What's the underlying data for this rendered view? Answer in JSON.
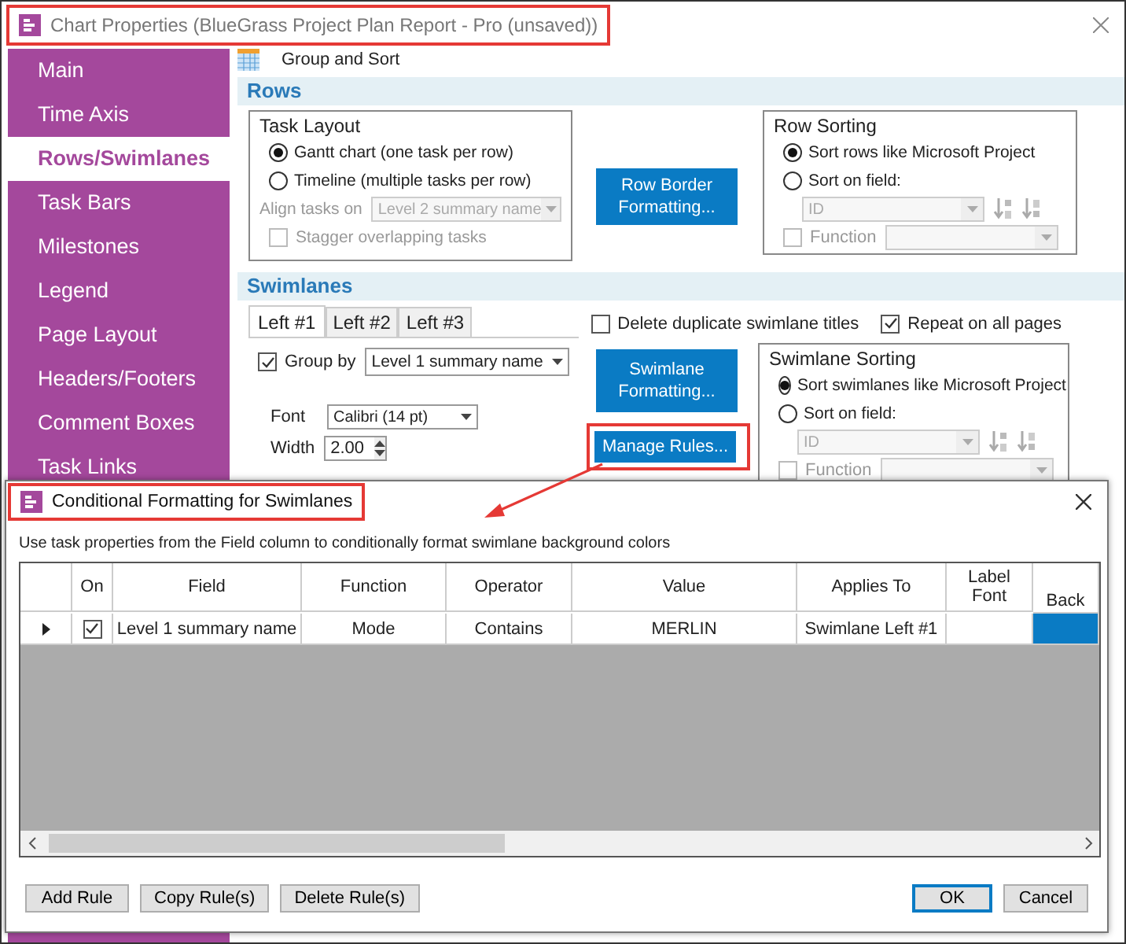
{
  "window": {
    "title": "Chart Properties (BlueGrass Project Plan Report - Pro (unsaved))"
  },
  "sidebar": {
    "items": [
      {
        "label": "Main",
        "selected": false
      },
      {
        "label": "Time Axis",
        "selected": false
      },
      {
        "label": "Rows/Swimlanes",
        "selected": true
      },
      {
        "label": "Task Bars",
        "selected": false
      },
      {
        "label": "Milestones",
        "selected": false
      },
      {
        "label": "Legend",
        "selected": false
      },
      {
        "label": "Page Layout",
        "selected": false
      },
      {
        "label": "Headers/Footers",
        "selected": false
      },
      {
        "label": "Comment Boxes",
        "selected": false
      },
      {
        "label": "Task Links",
        "selected": false
      }
    ]
  },
  "toolbar": {
    "label": "Group and Sort"
  },
  "rows_section": {
    "title": "Rows",
    "task_layout": {
      "title": "Task Layout",
      "options": [
        {
          "label": "Gantt chart (one task per row)",
          "selected": true
        },
        {
          "label": "Timeline (multiple tasks per row)",
          "selected": false
        }
      ],
      "align": {
        "label": "Align tasks on",
        "value": "Level 2 summary name",
        "disabled": true
      },
      "stagger": {
        "label": "Stagger overlapping tasks",
        "checked": false,
        "disabled": true
      }
    },
    "border_button": "Row Border Formatting...",
    "sorting": {
      "title": "Row Sorting",
      "options": [
        {
          "label": "Sort rows like Microsoft Project",
          "selected": true
        },
        {
          "label": "Sort on field:",
          "selected": false
        }
      ],
      "field": {
        "value": "ID",
        "disabled": true
      },
      "function": {
        "label": "Function",
        "checked": false,
        "disabled": true
      }
    }
  },
  "swimlanes_section": {
    "title": "Swimlanes",
    "tabs": [
      {
        "label": "Left #1",
        "selected": true
      },
      {
        "label": "Left #2",
        "selected": false
      },
      {
        "label": "Left #3",
        "selected": false
      }
    ],
    "delete_duplicates": {
      "label": "Delete duplicate swimlane titles",
      "checked": false
    },
    "repeat": {
      "label": "Repeat on all pages",
      "checked": true
    },
    "group_by": {
      "label": "Group by",
      "checked": true,
      "value": "Level 1 summary name"
    },
    "font": {
      "label": "Font",
      "value": "Calibri (14 pt)"
    },
    "width": {
      "label": "Width",
      "value": "2.00"
    },
    "format_button": "Swimlane Formatting...",
    "rules_button": "Manage Rules...",
    "sorting": {
      "title": "Swimlane Sorting",
      "options": [
        {
          "label": "Sort swimlanes like Microsoft Project",
          "selected": true
        },
        {
          "label": "Sort on field:",
          "selected": false
        }
      ],
      "field": {
        "value": "ID",
        "disabled": true
      },
      "function": {
        "label": "Function",
        "checked": false,
        "disabled": true
      }
    }
  },
  "dialog": {
    "title": "Conditional Formatting for Swimlanes",
    "description": "Use task properties from the Field column to conditionally format swimlane background colors",
    "table": {
      "columns": [
        "",
        "On",
        "Field",
        "Function",
        "Operator",
        "Value",
        "Applies To",
        "Label Font",
        "Back"
      ],
      "rows": [
        {
          "current": true,
          "on": true,
          "field": "Level 1 summary name",
          "function": "Mode",
          "operator": "Contains",
          "value": "MERLIN",
          "applies_to": "Swimlane Left #1",
          "color": "#0a7bc4"
        }
      ]
    },
    "buttons": [
      {
        "label": "Add Rule",
        "kind": "action"
      },
      {
        "label": "Copy Rule(s)",
        "kind": "action"
      },
      {
        "label": "Delete Rule(s)",
        "kind": "action"
      },
      {
        "label": "OK",
        "kind": "default"
      },
      {
        "label": "Cancel",
        "kind": "cancel"
      }
    ]
  }
}
